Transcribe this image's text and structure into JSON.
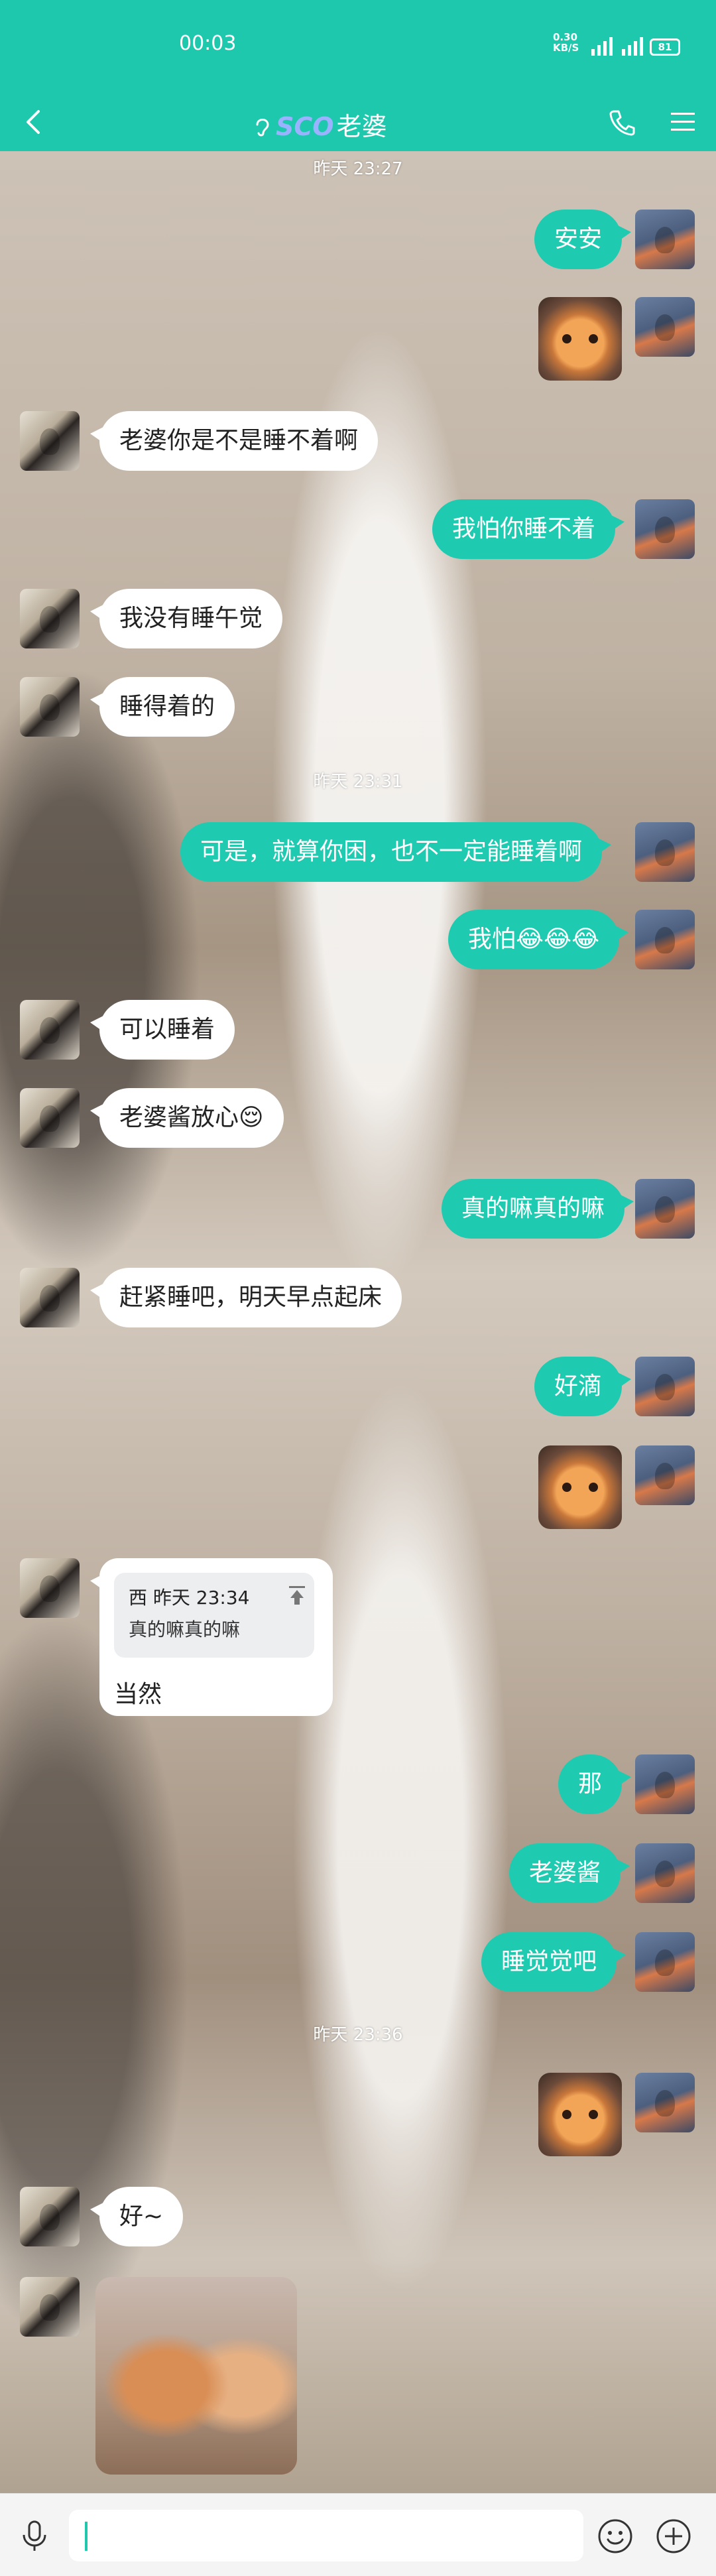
{
  "status": {
    "time": "00:03",
    "net_speed": "0.30",
    "net_unit": "KB/S",
    "battery": "81"
  },
  "header": {
    "account_tag": "SCO",
    "title": "老婆"
  },
  "timestamps": [
    "昨天 23:27",
    "昨天 23:31",
    "昨天 23:36"
  ],
  "messages": {
    "m1": "安安",
    "m2": "老婆你是不是睡不着啊",
    "m3": "我怕你睡不着",
    "m4": "我没有睡午觉",
    "m5": "睡得着的",
    "m6": "可是，就算你困，也不一定能睡着啊",
    "m7": "我怕😂😂😂",
    "m8": "可以睡着",
    "m9": "老婆酱放心😌",
    "m10": "真的嘛真的嘛",
    "m11": "赶紧睡吧，明天早点起床",
    "m12": "好滴",
    "m14": "那",
    "m15": "老婆酱",
    "m16": "睡觉觉吧",
    "m17": "好~"
  },
  "quote": {
    "meta": "西 昨天 23:34",
    "text": "真的嘛真的嘛",
    "reply": "当然"
  },
  "input": {
    "value": ""
  }
}
